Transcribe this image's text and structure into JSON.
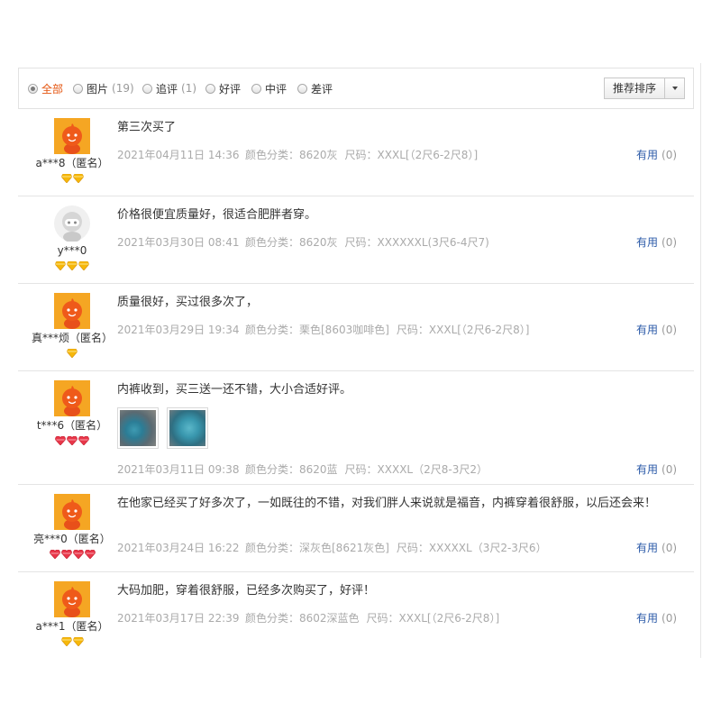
{
  "filters": [
    {
      "label": "全部",
      "count": "",
      "checked": true
    },
    {
      "label": "图片",
      "count": "(19)",
      "checked": false
    },
    {
      "label": "追评",
      "count": "(1)",
      "checked": false
    },
    {
      "label": "好评",
      "count": "",
      "checked": false
    },
    {
      "label": "中评",
      "count": "",
      "checked": false
    },
    {
      "label": "差评",
      "count": "",
      "checked": false
    }
  ],
  "sort": {
    "label": "推荐排序"
  },
  "colors": {
    "accent": "#e4540f",
    "link": "#2b5aa8",
    "meta": "#aaaaaa",
    "gold_gem": "#f6b80a",
    "red_gem": "#e8374a"
  },
  "reviews": [
    {
      "user": "a***8（匿名）",
      "avatar": "orange-mascot-avatar",
      "level_icon": "gold-diamond-icon",
      "level_count": 2,
      "content": "第三次买了",
      "date": "2021年04月11日 14:36",
      "sku": "颜色分类：8620灰",
      "size": "尺码：XXXL[（2尺6-2尺8）]",
      "useful_label": "有用",
      "useful_count": "(0)"
    },
    {
      "user": "y***0",
      "avatar": "gray-default-avatar",
      "level_icon": "gold-diamond-icon",
      "level_count": 3,
      "content": "价格很便宜质量好，很适合肥胖者穿。",
      "date": "2021年03月30日 08:41",
      "sku": "颜色分类：8620灰",
      "size": "尺码：XXXXXXL(3尺6-4尺7)",
      "useful_label": "有用",
      "useful_count": "(0)"
    },
    {
      "user": "真***烦（匿名）",
      "avatar": "orange-mascot-avatar",
      "level_icon": "gold-diamond-icon",
      "level_count": 1,
      "content": "质量很好，买过很多次了，",
      "date": "2021年03月29日 19:34",
      "sku": "颜色分类：栗色[8603咖啡色]",
      "size": "尺码：XXXL[（2尺6-2尺8）]",
      "useful_label": "有用",
      "useful_count": "(0)"
    },
    {
      "user": "t***6（匿名）",
      "avatar": "orange-mascot-avatar",
      "level_icon": "red-heart-icon",
      "level_count": 3,
      "content": "内裤收到，买三送一还不错，大小合适好评。",
      "date": "2021年03月11日 09:38",
      "sku": "颜色分类：8620蓝",
      "size": "尺码：XXXXL（2尺8-3尺2）",
      "useful_label": "有用",
      "useful_count": "(0)",
      "photos": [
        "photo-thumbnail-1",
        "photo-thumbnail-2"
      ]
    },
    {
      "user": "亮***0（匿名）",
      "avatar": "orange-mascot-avatar",
      "level_icon": "red-heart-icon",
      "level_count": 4,
      "content": "在他家已经买了好多次了，一如既往的不错，对我们胖人来说就是福音，内裤穿着很舒服，以后还会来！",
      "date": "2021年03月24日 16:22",
      "sku": "颜色分类：深灰色[8621灰色]",
      "size": "尺码：XXXXXL（3尺2-3尺6）",
      "useful_label": "有用",
      "useful_count": "(0)"
    },
    {
      "user": "a***1（匿名）",
      "avatar": "orange-mascot-avatar",
      "level_icon": "gold-diamond-icon",
      "level_count": 2,
      "content": "大码加肥，穿着很舒服，已经多次购买了，好评！",
      "date": "2021年03月17日 22:39",
      "sku": "颜色分类：8602深蓝色",
      "size": "尺码：XXXL[（2尺6-2尺8）]",
      "useful_label": "有用",
      "useful_count": "(0)"
    }
  ]
}
